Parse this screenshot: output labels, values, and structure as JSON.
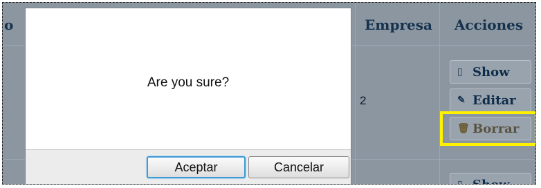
{
  "table": {
    "header_partial": "o",
    "header_empresa": "Empresa",
    "header_acciones": "Acciones",
    "row_value": "2",
    "actions": {
      "show_label": "Show",
      "edit_label": "Editar",
      "delete_label": "Borrar",
      "next_show_label": "Show"
    },
    "highlight_color": "#fff200"
  },
  "dialog": {
    "message": "Are you sure?",
    "ok_label": "Aceptar",
    "cancel_label": "Cancelar"
  },
  "icons": {
    "show": "document-icon",
    "edit": "pencil-icon",
    "delete": "trash-icon"
  }
}
